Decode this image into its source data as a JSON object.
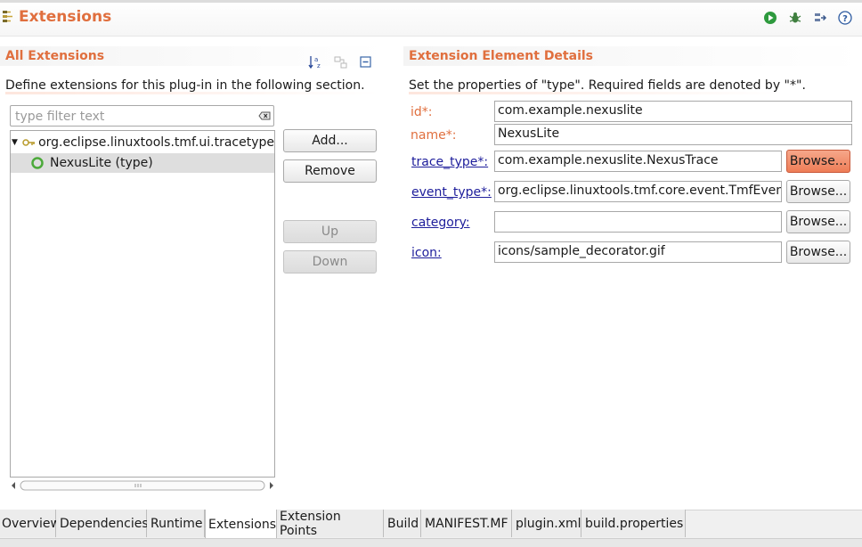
{
  "header": {
    "title": "Extensions",
    "icons": [
      "extensions-icon",
      "run-icon",
      "debug-icon",
      "export-icon",
      "help-icon"
    ],
    "accent_color": "#e06f3e"
  },
  "all_extensions": {
    "title": "All Extensions",
    "description": "Define extensions for this plug-in in the following section.",
    "toolbar_icons": [
      "sort-alpha-icon",
      "show-full-name-icon",
      "collapse-all-icon"
    ],
    "filter_placeholder": "type filter text",
    "tree": [
      {
        "label": "org.eclipse.linuxtools.tmf.ui.tracetype",
        "expanded": true,
        "icon": "extension-point-icon"
      },
      {
        "label": "NexusLite (type)",
        "selected": true,
        "icon": "element-icon"
      }
    ],
    "buttons": {
      "add": "Add...",
      "remove": "Remove",
      "up": "Up",
      "down": "Down"
    }
  },
  "details": {
    "title": "Extension Element Details",
    "description": "Set the properties of \"type\". Required fields are denoted by \"*\".",
    "fields": [
      {
        "label": "id*:",
        "value": "com.example.nexuslite"
      },
      {
        "label": "name*:",
        "value": "NexusLite"
      },
      {
        "label": "trace_type*:",
        "value": "com.example.nexuslite.NexusTrace",
        "browse": "Browse..."
      },
      {
        "label": "event_type*:",
        "value": "org.eclipse.linuxtools.tmf.core.event.TmfEvent",
        "browse": "Browse..."
      },
      {
        "label": "category:",
        "value": "",
        "browse": "Browse..."
      },
      {
        "label": "icon:",
        "value": "icons/sample_decorator.gif",
        "browse": "Browse..."
      }
    ]
  },
  "tabs": [
    {
      "label": "Overview"
    },
    {
      "label": "Dependencies"
    },
    {
      "label": "Runtime"
    },
    {
      "label": "Extensions",
      "active": true
    },
    {
      "label": "Extension Points"
    },
    {
      "label": "Build"
    },
    {
      "label": "MANIFEST.MF"
    },
    {
      "label": "plugin.xml"
    },
    {
      "label": "build.properties"
    }
  ]
}
